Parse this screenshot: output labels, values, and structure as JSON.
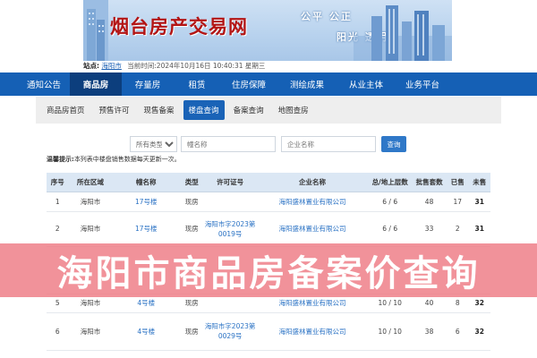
{
  "banner": {
    "logo_text": "烟台房产交易网",
    "slogan_line1": "公平  公正",
    "slogan_line2": "阳光  透明"
  },
  "siteinfo": {
    "site_label": "站点:",
    "city": "海阳市",
    "datetime": "当前时间:2024年10月16日 10:40:31 星期三"
  },
  "mainnav": {
    "items": [
      "通知公告",
      "商品房",
      "存量房",
      "租赁",
      "住房保障",
      "测绘成果",
      "从业主体",
      "业务平台"
    ]
  },
  "subnav": {
    "items": [
      "商品房首页",
      "预售许可",
      "现售备案",
      "楼盘查询",
      "备案查询",
      "地图查房"
    ]
  },
  "search": {
    "type_select": "所有类型",
    "building_placeholder": "幢名称",
    "company_placeholder": "企业名称",
    "button_label": "查询"
  },
  "tip": {
    "label": "温馨提示:",
    "text": "本列表中楼盘销售数据每天更新一次。"
  },
  "table": {
    "headers": [
      "序号",
      "所在区域",
      "幢名称",
      "类型",
      "许可证号",
      "企业名称",
      "总/地上层数",
      "批售套数",
      "已售",
      "未售"
    ],
    "rows": [
      {
        "no": "1",
        "area": "海阳市",
        "name": "17号楼",
        "type": "现房",
        "permit": "",
        "company": "海阳盛林置业有限公司",
        "floors": "6 / 6",
        "total": "48",
        "sold": "17",
        "unsold": "31"
      },
      {
        "no": "2",
        "area": "海阳市",
        "name": "17号楼",
        "type": "现房",
        "permit": "海阳市字2023第0019号",
        "company": "海阳盛林置业有限公司",
        "floors": "6 / 6",
        "total": "33",
        "sold": "2",
        "unsold": "31"
      },
      {
        "no": "",
        "area": "",
        "name": "",
        "type": "",
        "permit": "",
        "company": "",
        "floors": "",
        "total": "",
        "sold": "",
        "unsold": ""
      },
      {
        "no": "5",
        "area": "海阳市",
        "name": "4号楼",
        "type": "现房",
        "permit": "",
        "company": "海阳盛林置业有限公司",
        "floors": "10 / 10",
        "total": "40",
        "sold": "8",
        "unsold": "32"
      },
      {
        "no": "6",
        "area": "海阳市",
        "name": "4号楼",
        "type": "现房",
        "permit": "海阳市字2023第0029号",
        "company": "海阳盛林置业有限公司",
        "floors": "10 / 10",
        "total": "38",
        "sold": "6",
        "unsold": "32"
      }
    ]
  },
  "overlay": {
    "title": "海阳市商品房备案价查询"
  }
}
